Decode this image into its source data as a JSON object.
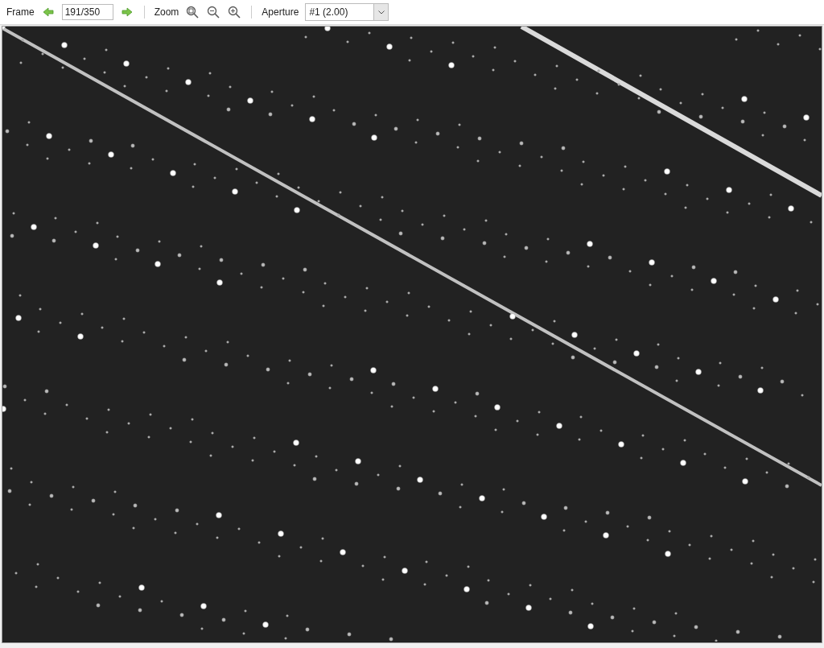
{
  "toolbar": {
    "frame_label": "Frame",
    "frame_value": "191/350",
    "zoom_label": "Zoom",
    "aperture_label": "Aperture",
    "aperture_value": "#1 (2.00)"
  }
}
